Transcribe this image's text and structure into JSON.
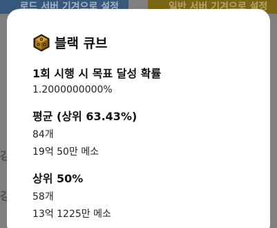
{
  "background": {
    "tab_left": "로드 서버 기겨으로 설정",
    "tab_right": "일반 서버 기겨으로 설정",
    "fragment_1": "강",
    "fragment_2": "강"
  },
  "card": {
    "icon": "black-cube-icon",
    "title": "블랙 큐브",
    "sections": [
      {
        "heading": "1회 시행 시 목표 달성 확률",
        "lines": [
          "1.2000000000%"
        ]
      },
      {
        "heading": "평균 (상위 63.43%)",
        "lines": [
          "84개",
          "19억 50만 메소"
        ]
      },
      {
        "heading": "상위 50%",
        "lines": [
          "58개",
          "13억 1225만 메소"
        ]
      }
    ]
  }
}
